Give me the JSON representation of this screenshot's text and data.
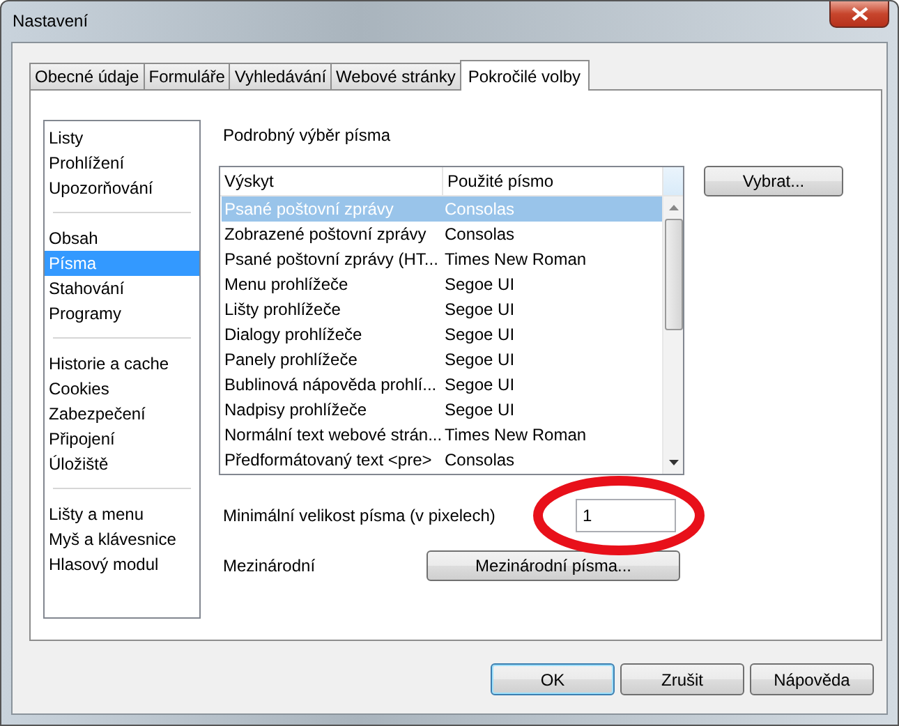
{
  "window": {
    "title": "Nastavení"
  },
  "tabs": [
    {
      "label": "Obecné údaje",
      "selected": false
    },
    {
      "label": "Formuláře",
      "selected": false
    },
    {
      "label": "Vyhledávání",
      "selected": false
    },
    {
      "label": "Webové stránky",
      "selected": false
    },
    {
      "label": "Pokročilé volby",
      "selected": true
    }
  ],
  "sidebar": {
    "groups": [
      {
        "items": [
          {
            "label": "Listy",
            "selected": false
          },
          {
            "label": "Prohlížení",
            "selected": false
          },
          {
            "label": "Upozorňování",
            "selected": false
          }
        ]
      },
      {
        "items": [
          {
            "label": "Obsah",
            "selected": false
          },
          {
            "label": "Písma",
            "selected": true
          },
          {
            "label": "Stahování",
            "selected": false
          },
          {
            "label": "Programy",
            "selected": false
          }
        ]
      },
      {
        "items": [
          {
            "label": "Historie a cache",
            "selected": false
          },
          {
            "label": "Cookies",
            "selected": false
          },
          {
            "label": "Zabezpečení",
            "selected": false
          },
          {
            "label": "Připojení",
            "selected": false
          },
          {
            "label": "Úložiště",
            "selected": false
          }
        ]
      },
      {
        "items": [
          {
            "label": "Lišty a menu",
            "selected": false
          },
          {
            "label": "Myš a klávesnice",
            "selected": false
          },
          {
            "label": "Hlasový modul",
            "selected": false
          }
        ]
      }
    ]
  },
  "section_title": "Podrobný výběr písma",
  "table": {
    "columns": [
      "Výskyt",
      "Použité písmo"
    ],
    "rows": [
      {
        "cells": [
          "Psané poštovní zprávy",
          "Consolas"
        ],
        "selected": true
      },
      {
        "cells": [
          "Zobrazené poštovní zprávy",
          "Consolas"
        ],
        "selected": false
      },
      {
        "cells": [
          "Psané poštovní zprávy (HT...",
          "Times New Roman"
        ],
        "selected": false
      },
      {
        "cells": [
          "Menu prohlížeče",
          "Segoe UI"
        ],
        "selected": false
      },
      {
        "cells": [
          "Lišty prohlížeče",
          "Segoe UI"
        ],
        "selected": false
      },
      {
        "cells": [
          "Dialogy prohlížeče",
          "Segoe UI"
        ],
        "selected": false
      },
      {
        "cells": [
          "Panely prohlížeče",
          "Segoe UI"
        ],
        "selected": false
      },
      {
        "cells": [
          "Bublinová nápověda prohlí...",
          "Segoe UI"
        ],
        "selected": false
      },
      {
        "cells": [
          "Nadpisy prohlížeče",
          "Segoe UI"
        ],
        "selected": false
      },
      {
        "cells": [
          "Normální text webové strán...",
          "Times New Roman"
        ],
        "selected": false
      },
      {
        "cells": [
          "Předformátovaný text <pre>",
          "Consolas"
        ],
        "selected": false
      }
    ]
  },
  "choose_button": "Vybrat...",
  "min_size": {
    "label": "Minimální velikost písma (v pixelech)",
    "value": "1"
  },
  "international": {
    "label": "Mezinárodní",
    "button": "Mezinárodní písma..."
  },
  "buttons": [
    {
      "label": "OK",
      "default": true
    },
    {
      "label": "Zrušit",
      "default": false
    },
    {
      "label": "Nápověda",
      "default": false
    }
  ]
}
